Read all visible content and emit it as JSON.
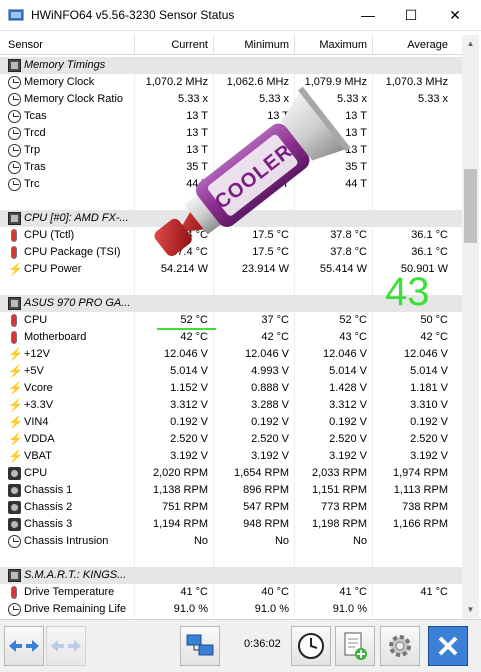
{
  "window": {
    "title": "HWiNFO64 v5.56-3230 Sensor Status",
    "minimize": "—",
    "maximize": "☐",
    "close": "✕"
  },
  "columns": {
    "sensor": "Sensor",
    "current": "Current",
    "minimum": "Minimum",
    "maximum": "Maximum",
    "average": "Average"
  },
  "rows": [
    {
      "type": "group",
      "icon": "chip-icon",
      "name": "Memory Timings"
    },
    {
      "type": "item",
      "icon": "clock-icon",
      "name": "Memory Clock",
      "current": "1,070.2 MHz",
      "minimum": "1,062.6 MHz",
      "maximum": "1,079.9 MHz",
      "average": "1,070.3 MHz"
    },
    {
      "type": "item",
      "icon": "clock-icon",
      "name": "Memory Clock Ratio",
      "current": "5.33 x",
      "minimum": "5.33 x",
      "maximum": "5.33 x",
      "average": "5.33 x"
    },
    {
      "type": "item",
      "icon": "clock-icon",
      "name": "Tcas",
      "current": "13 T",
      "minimum": "13 T",
      "maximum": "13 T",
      "average": ""
    },
    {
      "type": "item",
      "icon": "clock-icon",
      "name": "Trcd",
      "current": "13 T",
      "minimum": "13 T",
      "maximum": "13 T",
      "average": ""
    },
    {
      "type": "item",
      "icon": "clock-icon",
      "name": "Trp",
      "current": "13 T",
      "minimum": "13 T",
      "maximum": "13 T",
      "average": ""
    },
    {
      "type": "item",
      "icon": "clock-icon",
      "name": "Tras",
      "current": "35 T",
      "minimum": "35 T",
      "maximum": "35 T",
      "average": ""
    },
    {
      "type": "item",
      "icon": "clock-icon",
      "name": "Trc",
      "current": "44 T",
      "minimum": "44 T",
      "maximum": "44 T",
      "average": ""
    },
    {
      "type": "blank"
    },
    {
      "type": "group",
      "icon": "chip-icon",
      "name": "CPU [#0]: AMD FX-..."
    },
    {
      "type": "item",
      "icon": "thermometer-icon",
      "name": "CPU (Tctl)",
      "current": "37.4 °C",
      "minimum": "17.5 °C",
      "maximum": "37.8 °C",
      "average": "36.1 °C"
    },
    {
      "type": "item",
      "icon": "thermometer-icon",
      "name": "CPU Package (TSI)",
      "current": "37.4 °C",
      "minimum": "17.5 °C",
      "maximum": "37.8 °C",
      "average": "36.1 °C"
    },
    {
      "type": "item",
      "icon": "bolt-icon",
      "name": "CPU Power",
      "current": "54.214 W",
      "minimum": "23.914 W",
      "maximum": "55.414 W",
      "average": "50.901 W"
    },
    {
      "type": "blank"
    },
    {
      "type": "group",
      "icon": "chip-icon",
      "name": "ASUS 970 PRO GA..."
    },
    {
      "type": "item",
      "icon": "thermometer-icon",
      "name": "CPU",
      "current": "52 °C",
      "minimum": "37 °C",
      "maximum": "52 °C",
      "average": "50 °C"
    },
    {
      "type": "item",
      "icon": "thermometer-icon",
      "name": "Motherboard",
      "current": "42 °C",
      "minimum": "42 °C",
      "maximum": "43 °C",
      "average": "42 °C"
    },
    {
      "type": "item",
      "icon": "bolt-icon",
      "name": "+12V",
      "current": "12.046 V",
      "minimum": "12.046 V",
      "maximum": "12.046 V",
      "average": "12.046 V"
    },
    {
      "type": "item",
      "icon": "bolt-icon",
      "name": "+5V",
      "current": "5.014 V",
      "minimum": "4.993 V",
      "maximum": "5.014 V",
      "average": "5.014 V"
    },
    {
      "type": "item",
      "icon": "bolt-icon",
      "name": "Vcore",
      "current": "1.152 V",
      "minimum": "0.888 V",
      "maximum": "1.428 V",
      "average": "1.181 V"
    },
    {
      "type": "item",
      "icon": "bolt-icon",
      "name": "+3.3V",
      "current": "3.312 V",
      "minimum": "3.288 V",
      "maximum": "3.312 V",
      "average": "3.310 V"
    },
    {
      "type": "item",
      "icon": "bolt-icon",
      "name": "VIN4",
      "current": "0.192 V",
      "minimum": "0.192 V",
      "maximum": "0.192 V",
      "average": "0.192 V"
    },
    {
      "type": "item",
      "icon": "bolt-icon",
      "name": "VDDA",
      "current": "2.520 V",
      "minimum": "2.520 V",
      "maximum": "2.520 V",
      "average": "2.520 V"
    },
    {
      "type": "item",
      "icon": "bolt-icon",
      "name": "VBAT",
      "current": "3.192 V",
      "minimum": "3.192 V",
      "maximum": "3.192 V",
      "average": "3.192 V"
    },
    {
      "type": "item",
      "icon": "fan-icon",
      "name": "CPU",
      "current": "2,020 RPM",
      "minimum": "1,654 RPM",
      "maximum": "2,033 RPM",
      "average": "1,974 RPM"
    },
    {
      "type": "item",
      "icon": "fan-icon",
      "name": "Chassis 1",
      "current": "1,138 RPM",
      "minimum": "896 RPM",
      "maximum": "1,151 RPM",
      "average": "1,113 RPM"
    },
    {
      "type": "item",
      "icon": "fan-icon",
      "name": "Chassis 2",
      "current": "751 RPM",
      "minimum": "547 RPM",
      "maximum": "773 RPM",
      "average": "738 RPM"
    },
    {
      "type": "item",
      "icon": "fan-icon",
      "name": "Chassis 3",
      "current": "1,194 RPM",
      "minimum": "948 RPM",
      "maximum": "1,198 RPM",
      "average": "1,166 RPM"
    },
    {
      "type": "item",
      "icon": "clock-icon",
      "name": "Chassis Intrusion",
      "current": "No",
      "minimum": "No",
      "maximum": "No",
      "average": ""
    },
    {
      "type": "blank"
    },
    {
      "type": "group",
      "icon": "chip-icon",
      "name": "S.M.A.R.T.: KINGS..."
    },
    {
      "type": "item",
      "icon": "thermometer-icon",
      "name": "Drive Temperature",
      "current": "41 °C",
      "minimum": "40 °C",
      "maximum": "41 °C",
      "average": "41 °C"
    },
    {
      "type": "item",
      "icon": "clock-icon",
      "name": "Drive Remaining Life",
      "current": "91.0 %",
      "minimum": "91.0 %",
      "maximum": "91.0 %",
      "average": ""
    }
  ],
  "overlay": {
    "handwritten_number": "43",
    "tube_label": "COOLER"
  },
  "toolbar": {
    "elapsed": "0:36:02"
  }
}
